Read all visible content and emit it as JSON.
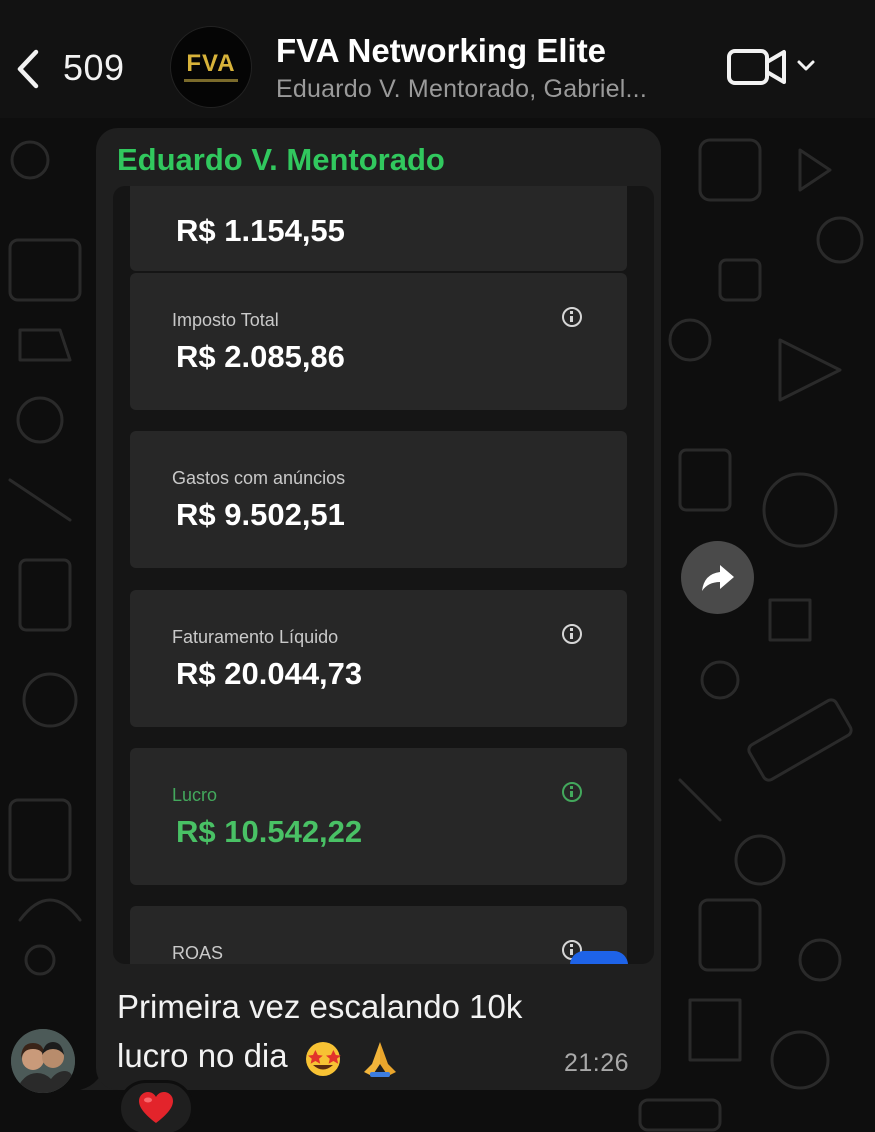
{
  "header": {
    "back_count": "509",
    "group_avatar_text": "FVA",
    "title": "FVA Networking Elite",
    "subtitle": "Eduardo V. Mentorado, Gabriel...",
    "icons": [
      "chevron-left-icon",
      "video-camera-icon",
      "chevron-down-icon"
    ]
  },
  "message": {
    "sender": "Eduardo V. Mentorado",
    "sender_color": "#31c85e",
    "screenshot": {
      "top_partial_value": "R$ 1.154,55",
      "cards": [
        {
          "label": "Imposto Total",
          "value": "R$ 2.085,86",
          "info": true
        },
        {
          "label": "Gastos com anúncios",
          "value": "R$ 9.502,51",
          "info": false
        },
        {
          "label": "Faturamento Líquido",
          "value": "R$ 20.044,73",
          "info": true
        },
        {
          "label": "Lucro",
          "value": "R$ 10.542,22",
          "info": true,
          "color": "#49c165"
        },
        {
          "label": "ROAS",
          "value": "",
          "info": true
        }
      ]
    },
    "caption_line1": "Primeira vez escalando 10k",
    "caption_line2": "lucro no dia",
    "caption_emojis": [
      "star-struck-emoji",
      "folded-hands-emoji"
    ],
    "time": "21:26",
    "reaction": "heart-emoji"
  },
  "colors": {
    "background": "#0e0e0e",
    "bubble": "#1f1f1f",
    "card": "#272727",
    "green": "#49c165"
  }
}
